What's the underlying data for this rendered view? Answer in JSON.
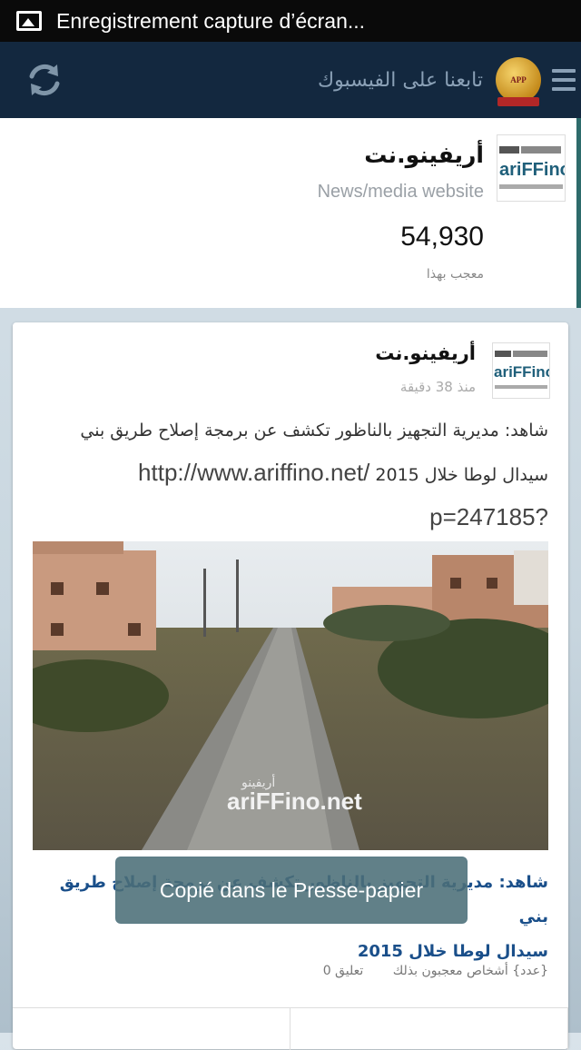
{
  "status_bar": {
    "notification_text": "Enregistrement capture d’écran..."
  },
  "app_bar": {
    "follow_text": "تابعنا على الفيسبوك",
    "logo_label": "APP",
    "icons": [
      "refresh-icon",
      "app-logo",
      "menu-icon"
    ]
  },
  "page": {
    "name": "أريفينو.نت",
    "category": "News/media website",
    "likes_count": "54,930",
    "likes_label": "معجب بهذا",
    "thumb_text": "ariFFino.net"
  },
  "post": {
    "author": "أريفينو.نت",
    "time": "منذ 38 دقيقة",
    "text_line1": "شاهد: مديرية التجهيز بالناظور تكشف عن برمجة إصلاح طريق بني",
    "text_line2": "سيدال لوطا خلال 2015",
    "url_part1": "http://www.ariffino.net/",
    "url_part2": "?p=247185",
    "image_watermark_arabic": "أريفينو",
    "image_watermark": "ariFFino.net",
    "link_title_line1": "شاهد: مديرية التجهيز بالناظور تكشف عن برمجة إصلاح طريق بني",
    "link_title_line2": "سيدال لوطا خلال 2015",
    "likes_meta": "{عدد} أشخاص معجبون بذلك",
    "comments_meta": "تعليق 0"
  },
  "toast": {
    "text": "Copié dans le Presse-papier"
  },
  "colors": {
    "app_bar": "#13283f",
    "link": "#1a4f8a",
    "accent": "#2d6b6b"
  }
}
